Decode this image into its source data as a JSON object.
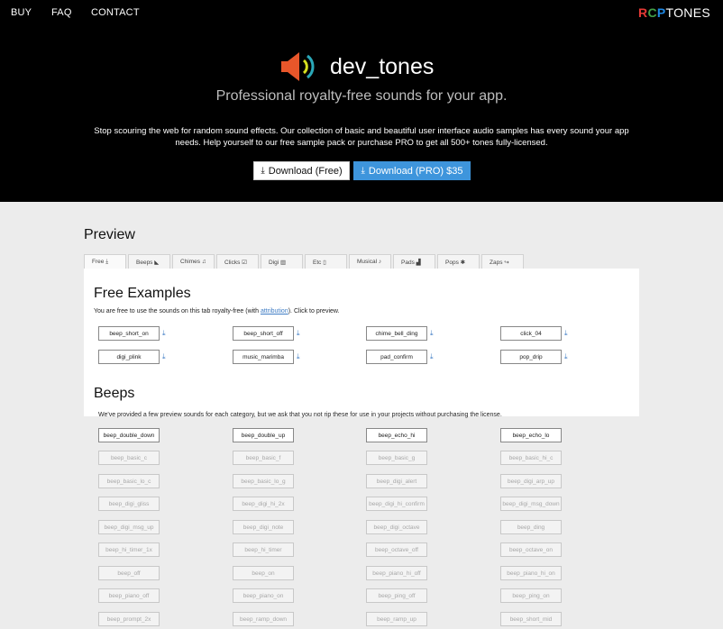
{
  "nav": {
    "items": [
      "BUY",
      "FAQ",
      "CONTACT"
    ]
  },
  "brand": {
    "r": "R",
    "c": "C",
    "p": "P",
    "rest": "TONES"
  },
  "hero": {
    "logo_text": "dev_tones",
    "tagline": "Professional royalty-free sounds for your app.",
    "intro": "Stop scouring the web for random sound effects. Our collection of basic and beautiful user interface audio samples has every sound your app needs. Help yourself to our free sample pack or purchase PRO to get all 500+ tones fully-licensed.",
    "download_free": "Download (Free)",
    "download_pro": "Download (PRO) $35"
  },
  "preview": {
    "title": "Preview",
    "tabs": [
      "Free",
      "Beeps",
      "Chimes",
      "Clicks",
      "Digi",
      "Etc",
      "Musical",
      "Pads",
      "Pops",
      "Zaps"
    ]
  },
  "free": {
    "title": "Free Examples",
    "note_before": "You are free to use the sounds on this tab royalty-free (with ",
    "note_link": "attribution",
    "note_after": "). Click to preview.",
    "sounds": [
      "beep_short_on",
      "beep_short_off",
      "chime_bell_ding",
      "click_04",
      "digi_plink",
      "music_marimba",
      "pad_confirm",
      "pop_drip"
    ]
  },
  "beeps": {
    "title": "Beeps",
    "note": "We've provided a few preview sounds for each category, but we ask that you not rip these for use in your projects without purchasing the license.",
    "sounds": [
      "beep_double_down",
      "beep_double_up",
      "beep_echo_hi",
      "beep_echo_lo"
    ],
    "locked": [
      "beep_basic_c",
      "beep_basic_f",
      "beep_basic_g",
      "beep_basic_hi_c",
      "beep_basic_lo_c",
      "beep_basic_lo_g",
      "beep_digi_alert",
      "beep_digi_arp_up",
      "beep_digi_gliss",
      "beep_digi_hi_2x",
      "beep_digi_hi_confirm",
      "beep_digi_msg_down",
      "beep_digi_msg_up",
      "beep_digi_note",
      "beep_digi_octave",
      "beep_ding",
      "beep_hi_timer_1x",
      "beep_hi_timer",
      "beep_octave_off",
      "beep_octave_on",
      "beep_off",
      "beep_on",
      "beep_piano_hi_off",
      "beep_piano_hi_on",
      "beep_piano_off",
      "beep_piano_on",
      "beep_ping_off",
      "beep_ping_on",
      "beep_prompt_2x",
      "beep_ramp_down",
      "beep_ramp_up",
      "beep_short_mid"
    ]
  },
  "colors": {
    "accent": "#3e95dc",
    "hero_bg": "#000000",
    "page_bg": "#ececec"
  },
  "icons": {
    "download": "download-icon",
    "speaker": "speaker-icon"
  }
}
